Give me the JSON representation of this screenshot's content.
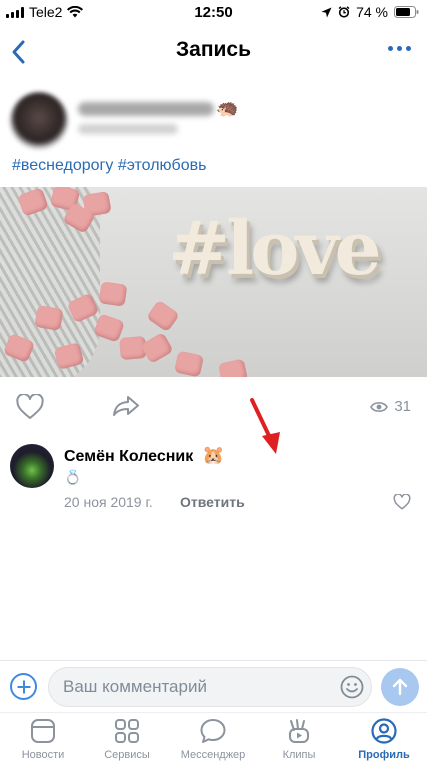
{
  "status_bar": {
    "carrier": "Tele2",
    "time": "12:50",
    "battery": "74 %"
  },
  "nav": {
    "title": "Запись"
  },
  "post": {
    "hashtags": "#веснедорогу #этолюбовь",
    "photo_text": "#love",
    "views": "31"
  },
  "comment": {
    "author": "Семён Колесник",
    "date": "20 ноя 2019 г.",
    "reply_label": "Ответить"
  },
  "comment_input": {
    "placeholder": "Ваш комментарий"
  },
  "tabs": [
    {
      "label": "Новости",
      "icon": "news-icon"
    },
    {
      "label": "Сервисы",
      "icon": "services-icon"
    },
    {
      "label": "Мессенджер",
      "icon": "messenger-icon"
    },
    {
      "label": "Клипы",
      "icon": "clips-icon"
    },
    {
      "label": "Профиль",
      "icon": "profile-icon"
    }
  ],
  "colors": {
    "accent": "#2a6bb5",
    "secondary_text": "#8c939c",
    "annotation_arrow": "#e02020"
  }
}
